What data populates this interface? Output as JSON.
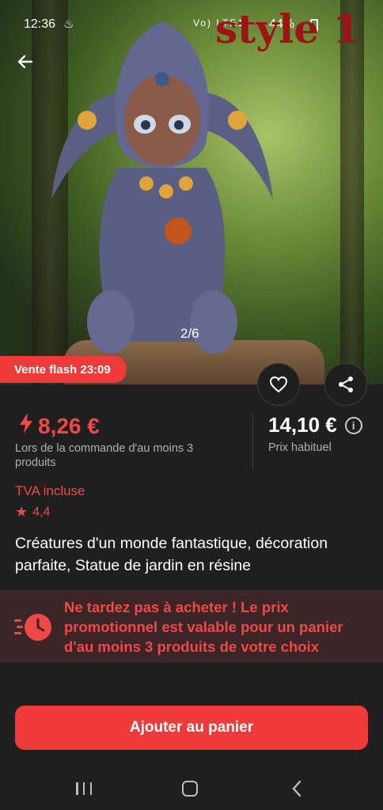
{
  "status_bar": {
    "time": "12:36",
    "battery": "44%",
    "network": "Vo) LTE1"
  },
  "watermark": "style 1",
  "image_counter": "2/6",
  "flash_sale": {
    "label": "Vente flash 23:09"
  },
  "price": {
    "sale": "8,26 €",
    "condition": "Lors de la commande d'au moins 3 produits",
    "regular": "14,10 €",
    "regular_label": "Prix habituel"
  },
  "tva": "TVA incluse",
  "rating": "4,4",
  "product_title": "Créatures d'un monde fantastique, décoration parfaite, Statue de jardin en résine",
  "promo": {
    "text": "Ne tardez pas à acheter ! Le prix promotionnel est valable pour un panier d'au moins 3 produits de votre choix"
  },
  "cta": {
    "add_to_cart": "Ajouter au panier"
  },
  "colors": {
    "accent": "#f03a3a",
    "background": "#1f1f1f",
    "promo_bg": "#3b2526"
  },
  "icons": [
    "back-arrow-icon",
    "heart-icon",
    "share-icon",
    "info-icon",
    "bolt-icon",
    "star-icon",
    "clock-icon"
  ]
}
